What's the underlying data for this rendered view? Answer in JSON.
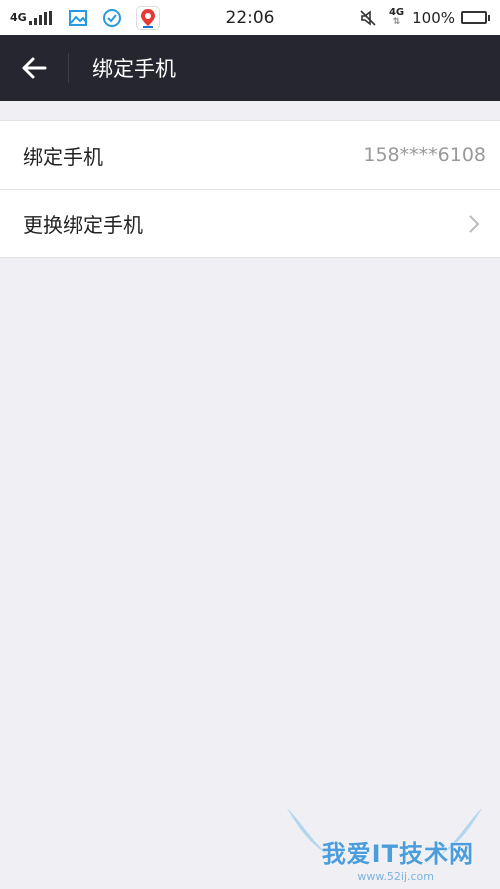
{
  "status_bar": {
    "network": "4G",
    "time": "22:06",
    "data_network": "4G",
    "battery": "100%",
    "battery_level": 1.0,
    "icons": [
      "signal-icon",
      "gallery-icon",
      "check-circle-icon",
      "baidu-app-icon",
      "mute-icon",
      "battery-icon"
    ]
  },
  "nav": {
    "title": "绑定手机",
    "back_icon": "arrow-left-icon"
  },
  "list": {
    "items": [
      {
        "label": "绑定手机",
        "value": "158****6108"
      },
      {
        "label": "更换绑定手机"
      }
    ]
  },
  "watermark": {
    "text": "我爱IT技术网",
    "sub": "www.52ij.com"
  },
  "colors": {
    "nav_bg": "#25262f",
    "page_bg": "#efeff4",
    "battery_fill": "#22c93a",
    "watermark": "#2f8fd8"
  }
}
